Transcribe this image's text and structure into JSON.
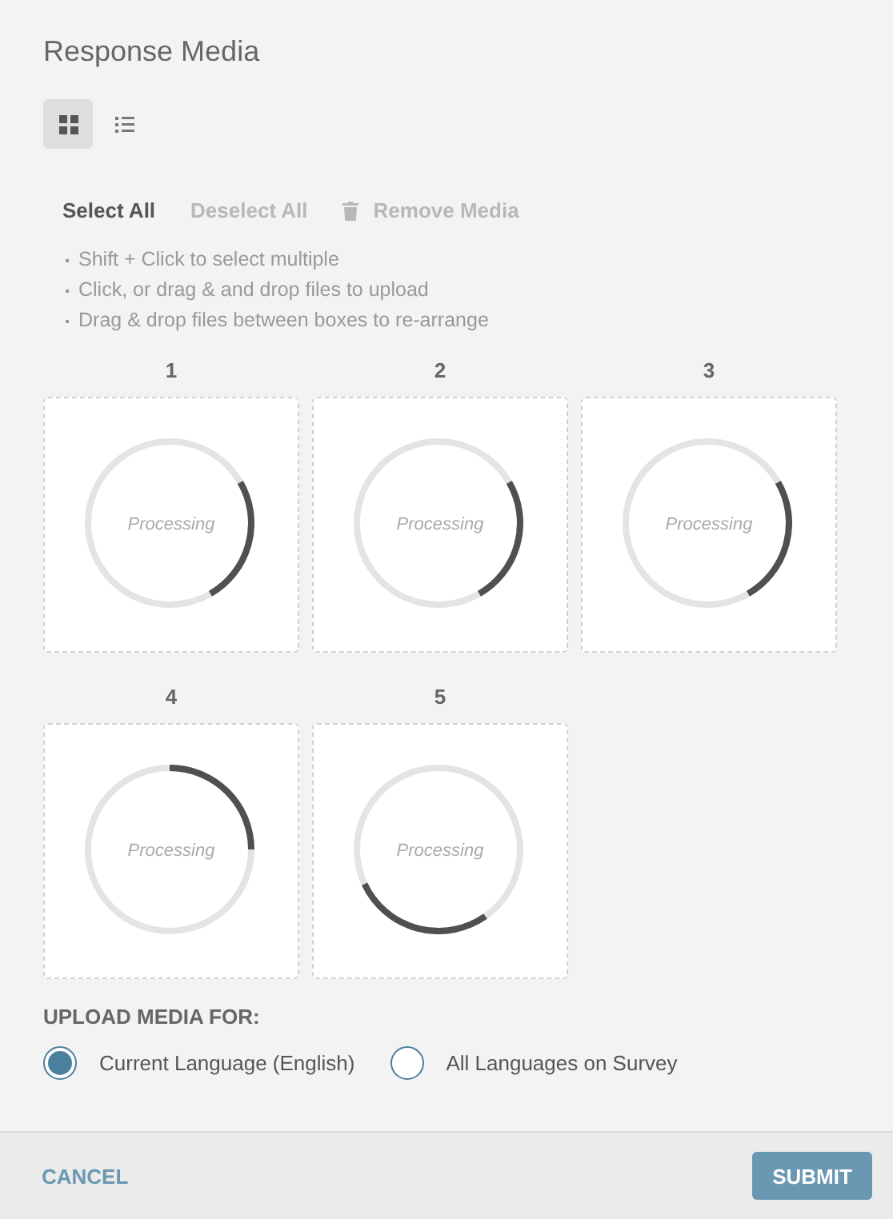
{
  "title": "Response Media",
  "view_toggle": [
    {
      "kind": "grid",
      "selected": true
    },
    {
      "kind": "list",
      "selected": false
    }
  ],
  "actions": [
    {
      "label": "Select All",
      "disabled": false
    },
    {
      "label": "Deselect All",
      "disabled": true
    },
    {
      "label": "Remove Media",
      "disabled": true,
      "kind": "trash"
    }
  ],
  "hints": [
    "Shift + Click to select multiple",
    "Click, or drag & and drop files to upload",
    "Drag & drop files between boxes to re-arrange"
  ],
  "media": [
    {
      "number": "1",
      "status": "Processing"
    },
    {
      "number": "2",
      "status": "Processing"
    },
    {
      "number": "3",
      "status": "Processing"
    },
    {
      "number": "4",
      "status": "Processing"
    },
    {
      "number": "5",
      "status": "Processing"
    }
  ],
  "upload_for": {
    "label": "UPLOAD MEDIA FOR:",
    "options": [
      {
        "label": "Current Language (English)",
        "selected": true
      },
      {
        "label": "All Languages on Survey",
        "selected": false
      }
    ]
  },
  "footer": {
    "cancel": "CANCEL",
    "submit": "SUBMIT"
  }
}
